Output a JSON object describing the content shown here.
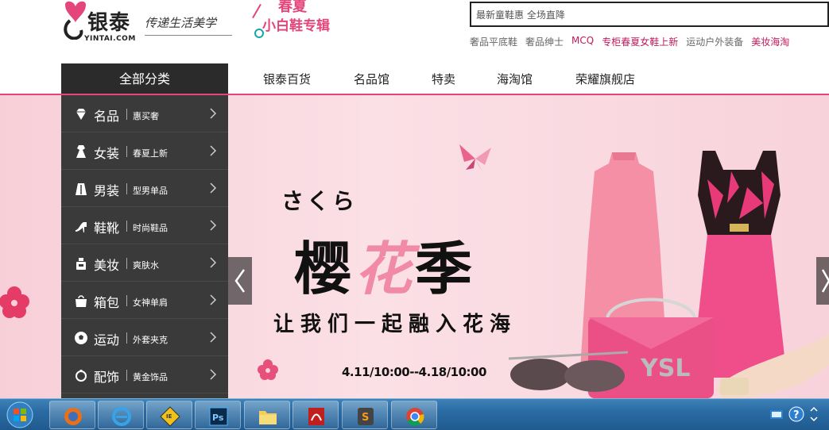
{
  "logo": {
    "brand": "银泰",
    "brand_sub": "YINTAI.COM",
    "slogan": "传递生活美学"
  },
  "promo": {
    "line1": "春夏",
    "line2": "小白鞋专辑"
  },
  "search": {
    "value": "最新童鞋惠 全场直降"
  },
  "hot_links": [
    {
      "label": "奢品平底鞋",
      "highlight": false
    },
    {
      "label": "奢品绅士",
      "highlight": false
    },
    {
      "label": "MCQ",
      "highlight": true
    },
    {
      "label": "专柜春夏女鞋上新",
      "highlight": true
    },
    {
      "label": "运动户外装备",
      "highlight": false
    },
    {
      "label": "美妆海淘",
      "highlight": true
    }
  ],
  "category_header": "全部分类",
  "nav": [
    "银泰百货",
    "名品馆",
    "特卖",
    "海淘馆",
    "荣耀旗舰店"
  ],
  "categories": [
    {
      "icon": "diamond-icon",
      "main": "名品",
      "sub": "惠买奢"
    },
    {
      "icon": "dress-icon",
      "main": "女装",
      "sub": "春夏上新"
    },
    {
      "icon": "suit-icon",
      "main": "男装",
      "sub": "型男单品"
    },
    {
      "icon": "high-heel-icon",
      "main": "鞋靴",
      "sub": "时尚鞋品"
    },
    {
      "icon": "perfume-icon",
      "main": "美妆",
      "sub": "爽肤水"
    },
    {
      "icon": "handbag-icon",
      "main": "箱包",
      "sub": "女神单肩"
    },
    {
      "icon": "soccer-ball-icon",
      "main": "运动",
      "sub": "外套夹克"
    },
    {
      "icon": "ring-icon",
      "main": "配饰",
      "sub": "黄金饰品"
    }
  ],
  "banner": {
    "kana": "さくら",
    "title_a": "樱",
    "title_b": "花",
    "title_c": "季",
    "subtitle": "让我们一起融入花海",
    "dates": "4.11/10:00--4.18/10:00"
  },
  "taskbar": {
    "apps": [
      "firefox-icon",
      "internet-explorer-icon",
      "ie-tester-icon",
      "photoshop-icon",
      "file-explorer-icon",
      "acrobat-icon",
      "sublime-text-icon",
      "chrome-icon"
    ]
  },
  "colors": {
    "accent": "#e4457a",
    "sidebar": "#3a3a3a",
    "taskbar": "#2a6ba3"
  }
}
